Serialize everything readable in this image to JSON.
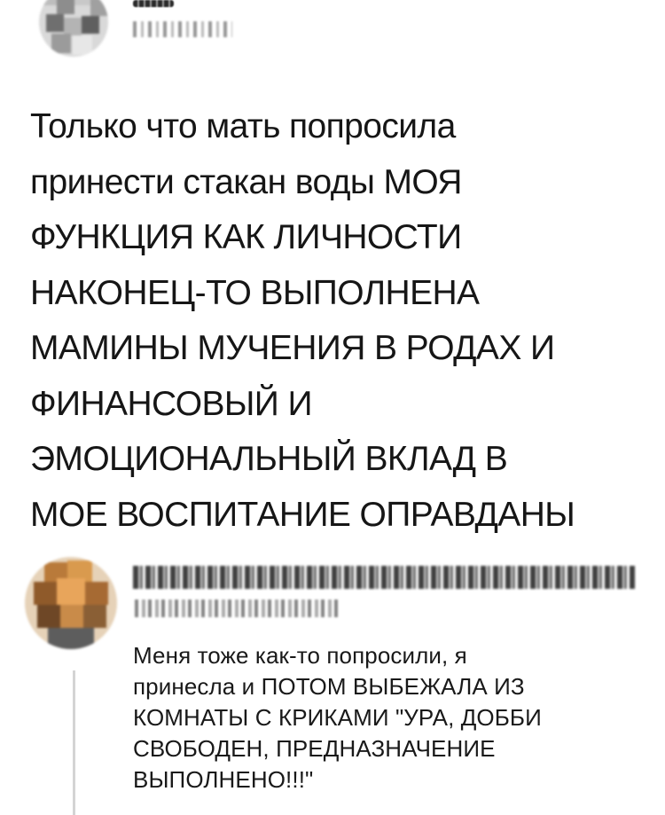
{
  "tweet": {
    "text": "Только что мать попросила\nпринести стакан воды МОЯ\nФУНКЦИЯ КАК ЛИЧНОСТИ\nНАКОНЕЦ-ТО ВЫПОЛНЕНА\nМАМИНЫ МУЧЕНИЯ В РОДАХ И\nФИНАНСОВЫЙ И\nЭМОЦИОНАЛЬНЫЙ ВКЛАД В\nМОЕ ВОСПИТАНИЕ ОПРАВДАНЫ"
  },
  "reply": {
    "text": "Меня тоже как-то попросили, я\nпринесла и ПОТОМ ВЫБЕЖАЛА ИЗ\nКОМНАТЫ С КРИКАМИ \"УРА, ДОББИ\nСВОБОДЕН, ПРЕДНАЗНАЧЕНИЕ\nВЫПОЛНЕНО!!!\""
  },
  "colors": {
    "text": "#161616",
    "thread_line": "#d4d4d4",
    "background": "#ffffff"
  }
}
